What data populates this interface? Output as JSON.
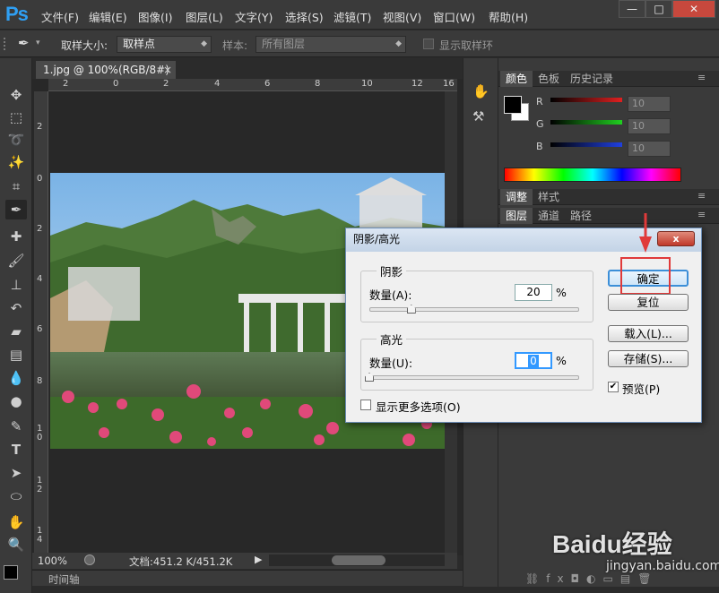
{
  "app": {
    "logo": "Ps"
  },
  "menu": [
    "文件(F)",
    "编辑(E)",
    "图像(I)",
    "图层(L)",
    "文字(Y)",
    "选择(S)",
    "滤镜(T)",
    "视图(V)",
    "窗口(W)",
    "帮助(H)"
  ],
  "window_controls": {
    "minimize": "—",
    "maximize": "□",
    "close": "✕"
  },
  "options_bar": {
    "sample_size_label": "取样大小:",
    "sample_size_value": "取样点",
    "sample_label": "样本:",
    "sample_value": "所有图层",
    "show_ring_label": "显示取样环"
  },
  "document": {
    "tab_title": "1.jpg @ 100%(RGB/8#)",
    "tab_close": "×",
    "ruler_top": [
      "2",
      "0",
      "2",
      "4",
      "6",
      "8",
      "10",
      "12",
      "14",
      "16"
    ],
    "ruler_left": [
      "2",
      "0",
      "2",
      "4",
      "6",
      "8",
      "1\n0",
      "1\n2",
      "1\n4"
    ],
    "zoom": "100%",
    "doc_info": "文档:451.2 K/451.2K",
    "timeline_tab": "时间轴"
  },
  "panels": {
    "color_tabs": [
      "颜色",
      "色板",
      "历史记录"
    ],
    "color_channels": [
      {
        "label": "R",
        "value": "10"
      },
      {
        "label": "G",
        "value": "10"
      },
      {
        "label": "B",
        "value": "10"
      }
    ],
    "adjust_tabs": [
      "调整",
      "样式"
    ],
    "layer_tabs": [
      "图层",
      "通道",
      "路径"
    ]
  },
  "dialog": {
    "title": "阴影/高光",
    "close": "x",
    "shadow": {
      "label": "阴影",
      "amount_label": "数量(A):",
      "amount": "20",
      "unit": "%",
      "slider_fraction": 0.2
    },
    "highlight": {
      "label": "高光",
      "amount_label": "数量(U):",
      "amount": "0",
      "unit": "%",
      "slider_fraction": 0.0
    },
    "more_options": "显示更多选项(O)",
    "buttons": {
      "ok": "确定",
      "reset": "复位",
      "load": "载入(L)...",
      "save": "存储(S)..."
    },
    "preview_label": "预览(P)",
    "preview_checked": true
  },
  "watermark": {
    "brand": "Baidu经验",
    "url": "jingyan.baidu.com"
  },
  "colors": {
    "accent_red": "#e03a3a",
    "ps_blue": "#2f9ff3",
    "dialog_bg": "#f0f0f0"
  }
}
